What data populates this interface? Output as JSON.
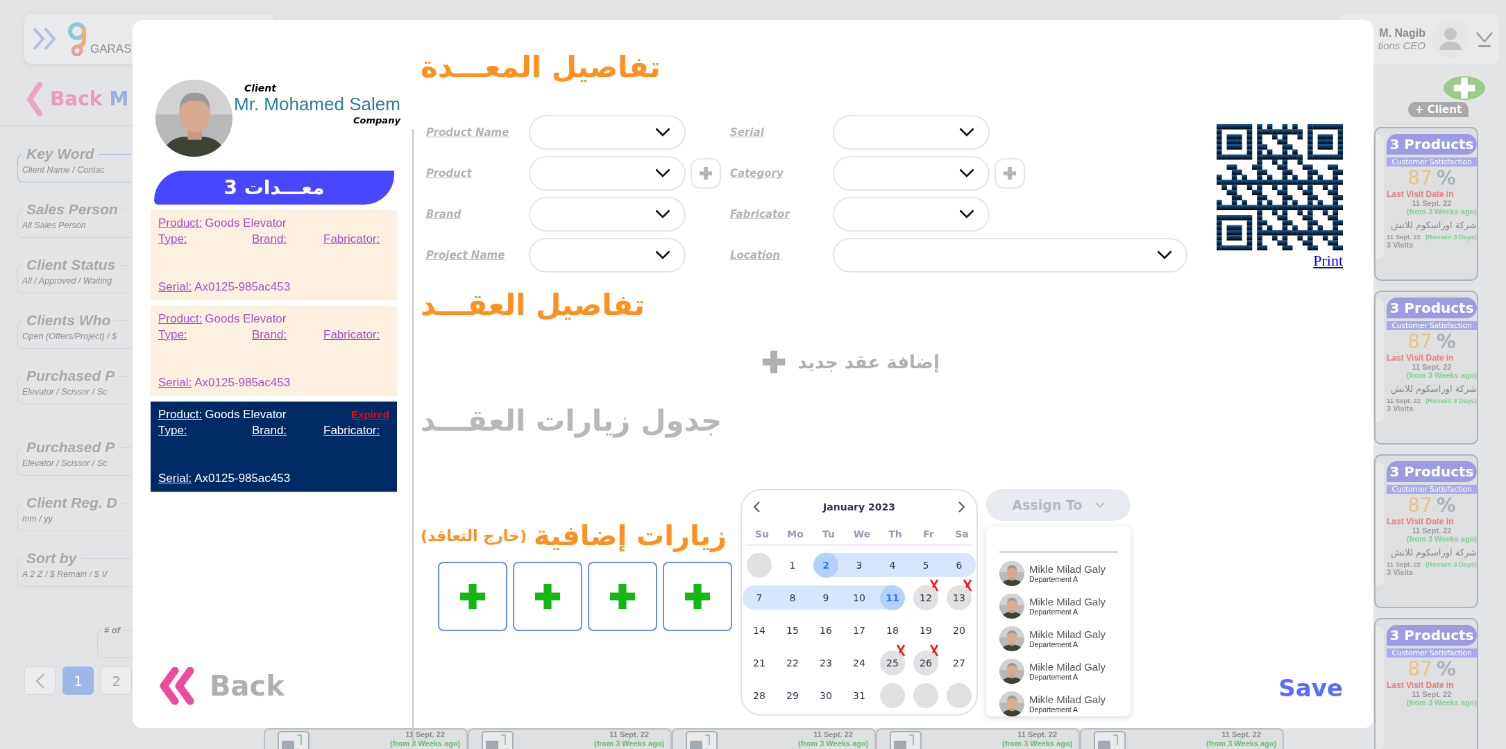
{
  "topbar": {
    "logo_text": "GARAS",
    "user_name": "M. Nagib",
    "user_role": "tions CEO"
  },
  "page": {
    "back": "Back",
    "title": "M"
  },
  "filters": [
    {
      "title": "Key Word",
      "placeholder": "Client Name / Contac",
      "selected": true
    },
    {
      "title": "Sales Person",
      "placeholder": "All Sales Person",
      "selected": false
    },
    {
      "title": "Client Status",
      "placeholder": "All / Approved / Waiting",
      "selected": false
    },
    {
      "title": "Clients Who",
      "placeholder": "Open (Offers/Project) / $",
      "selected": false
    },
    {
      "title": "Purchased P",
      "placeholder": "Elevator / Scissor / Sc",
      "selected": false
    },
    {
      "title": "Purchased P",
      "placeholder": "Elevator / Scissor / Sc",
      "selected": false
    },
    {
      "title": "Client Reg. D",
      "placeholder": "mm / yy",
      "selected": false
    },
    {
      "title": "Sort by",
      "placeholder": "A 2 Z / $ Remain / $ V",
      "selected": false
    }
  ],
  "count_label": "# of",
  "pagination": [
    {
      "label": "1",
      "selected": true
    },
    {
      "label": "2",
      "selected": false
    }
  ],
  "add_client": "+ Client",
  "client_cards": [
    {
      "products": "3 Products",
      "satisfaction_label": "Customer Satisfaction",
      "satisfaction": "87",
      "percent": "%",
      "last_visit_label": "Last Visit Date in",
      "last_visit_date": "11 Sept. 22",
      "last_visit_ago": "(from 3 Weeks ago)",
      "company": "شركة اوراسكوم للانش",
      "next_date": "11 Sept. 22",
      "remain": "(Remain 3 Days)",
      "visits": "3 Visits"
    },
    {
      "products": "3 Products",
      "satisfaction_label": "Customer Satisfaction",
      "satisfaction": "87",
      "percent": "%",
      "last_visit_label": "Last Visit Date in",
      "last_visit_date": "11 Sept. 22",
      "last_visit_ago": "(from 3 Weeks ago)",
      "company": "شركة اوراسكوم للانش",
      "next_date": "11 Sept. 22",
      "remain": "(Remain 3 Days)",
      "visits": "3 Visits"
    },
    {
      "products": "3 Products",
      "satisfaction_label": "Customer Satisfaction",
      "satisfaction": "87",
      "percent": "%",
      "last_visit_label": "Last Visit Date in",
      "last_visit_date": "11 Sept. 22",
      "last_visit_ago": "(from 3 Weeks ago)",
      "company": "شركة اوراسكوم للانش",
      "next_date": "11 Sept. 22",
      "remain": "(Remain 3 Days)",
      "visits": "3 Visits"
    },
    {
      "products": "3 Products",
      "satisfaction_label": "Customer Satisfaction",
      "satisfaction": "87",
      "percent": "%",
      "last_visit_label": "Last Visit Date in",
      "last_visit_date": "11 Sept. 22",
      "last_visit_ago": "(from 3 Weeks ago)"
    }
  ],
  "bottom_cards": [
    {
      "date": "11 Sept. 22",
      "ago": "(from 3 Weeks ago)"
    },
    {
      "date": "11 Sept. 22",
      "ago": "(from 3 Weeks ago)"
    },
    {
      "date": "11 Sept. 22",
      "ago": "(from 3 Weeks ago)"
    },
    {
      "date": "11 Sept. 22",
      "ago": "(from 3 Weeks ago)"
    },
    {
      "date": "11 Sept. 22",
      "ago": "(from 3 Weeks ago)"
    }
  ],
  "modal": {
    "client": {
      "label": "Client",
      "name": "Mr. Mohamed Salem",
      "company": "Company"
    },
    "equipment_banner": "معـــدات 3",
    "equipment": [
      {
        "product_label": "Product:",
        "product": "Goods Elevator",
        "type_label": "Type:",
        "brand_label": "Brand:",
        "fabricator_label": "Fabricator:",
        "serial_label": "Serial:",
        "serial": "Ax0125-985ac453",
        "selected": false
      },
      {
        "product_label": "Product:",
        "product": "Goods Elevator",
        "type_label": "Type:",
        "brand_label": "Brand:",
        "fabricator_label": "Fabricator:",
        "serial_label": "Serial:",
        "serial": "Ax0125-985ac453",
        "selected": false
      },
      {
        "product_label": "Product:",
        "product": "Goods Elevator",
        "type_label": "Type:",
        "brand_label": "Brand:",
        "fabricator_label": "Fabricator:",
        "serial_label": "Serial:",
        "serial": "Ax0125-985ac453",
        "selected": true,
        "badge": "Expired"
      }
    ],
    "equipment_title": "تفاصيل المعـــدة",
    "fields": [
      {
        "label": "Product Name",
        "add": false,
        "wide": false
      },
      {
        "label": "Serial",
        "add": false,
        "wide": false
      },
      {
        "label": "Product",
        "add": true,
        "wide": false
      },
      {
        "label": "Category",
        "add": true,
        "wide": false
      },
      {
        "label": "Brand",
        "add": false,
        "wide": false
      },
      {
        "label": "Fabricator",
        "add": false,
        "wide": false
      },
      {
        "label": "Project Name",
        "add": false,
        "wide": false
      },
      {
        "label": "Location",
        "add": false,
        "wide": true
      }
    ],
    "print": "Print",
    "contract_title": "تفاصيل العقـــد",
    "add_contract": "إضافة عقد جديد",
    "visits_title": "جدول زيارات العقـــد",
    "extra_visits_title": "زيارات إضافية",
    "extra_visits_note": "(خارج التعاقد)",
    "extra_visits": [
      {
        "kind": "empty"
      },
      {
        "kind": "empty"
      },
      {
        "kind": "empty"
      },
      {
        "kind": "empty"
      }
    ],
    "calendar": {
      "month": "January 2023",
      "weekdays": [
        "Su",
        "Mo",
        "Tu",
        "We",
        "Th",
        "Fr",
        "Sa"
      ],
      "days": [
        {
          "kind": "empty"
        },
        {
          "label": "1",
          "kind": "day"
        },
        {
          "label": "2",
          "kind": "range-start"
        },
        {
          "label": "3",
          "kind": "range"
        },
        {
          "label": "4",
          "kind": "range"
        },
        {
          "label": "5",
          "kind": "range"
        },
        {
          "label": "6",
          "kind": "range"
        },
        {
          "label": "7",
          "kind": "range"
        },
        {
          "label": "8",
          "kind": "range"
        },
        {
          "label": "9",
          "kind": "range"
        },
        {
          "label": "10",
          "kind": "range"
        },
        {
          "label": "11",
          "kind": "range-end"
        },
        {
          "label": "12",
          "kind": "blocked"
        },
        {
          "label": "13",
          "kind": "blocked"
        },
        {
          "label": "14",
          "kind": "day"
        },
        {
          "label": "15",
          "kind": "day"
        },
        {
          "label": "16",
          "kind": "day"
        },
        {
          "label": "17",
          "kind": "day"
        },
        {
          "label": "18",
          "kind": "day"
        },
        {
          "label": "19",
          "kind": "day"
        },
        {
          "label": "20",
          "kind": "day"
        },
        {
          "label": "21",
          "kind": "day"
        },
        {
          "label": "22",
          "kind": "day"
        },
        {
          "label": "23",
          "kind": "day"
        },
        {
          "label": "24",
          "kind": "day"
        },
        {
          "label": "25",
          "kind": "blocked"
        },
        {
          "label": "26",
          "kind": "blocked"
        },
        {
          "label": "27",
          "kind": "day"
        },
        {
          "label": "28",
          "kind": "day"
        },
        {
          "label": "29",
          "kind": "day"
        },
        {
          "label": "30",
          "kind": "day"
        },
        {
          "label": "31",
          "kind": "day"
        },
        {
          "kind": "empty"
        },
        {
          "kind": "empty"
        },
        {
          "kind": "empty"
        }
      ]
    },
    "assign": {
      "label": "Assign To",
      "people": [
        {
          "name": "Mikle Milad Galy",
          "department": "Departement A"
        },
        {
          "name": "Mikle Milad Galy",
          "department": "Departement A"
        },
        {
          "name": "Mikle Milad Galy",
          "department": "Departement A"
        },
        {
          "name": "Mikle Milad Galy",
          "department": "Departement A"
        },
        {
          "name": "Mikle Milad Galy",
          "department": "Departement A"
        }
      ]
    },
    "back": "Back",
    "save": "Save"
  }
}
